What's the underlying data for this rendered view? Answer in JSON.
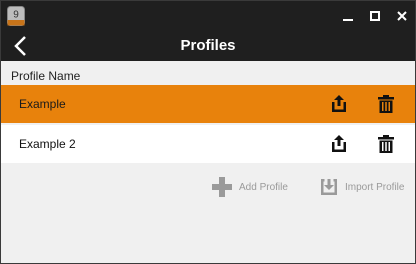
{
  "titlebar": {
    "app_badge": "9",
    "minimize_glyph": "_",
    "maximize_glyph": "□",
    "close_glyph": "✕"
  },
  "navbar": {
    "title": "Profiles",
    "back_icon": "chevron-left-icon"
  },
  "profiles": {
    "column_header": "Profile Name",
    "rows": [
      {
        "name": "Example",
        "selected": true
      },
      {
        "name": "Example 2",
        "selected": false
      }
    ],
    "row_icons": [
      "export-icon",
      "trash-icon"
    ]
  },
  "actions": {
    "add_label": "Add Profile",
    "import_label": "Import Profile"
  },
  "colors": {
    "accent": "#e8820c",
    "titlebar": "#1f1f1f",
    "background": "#f0f0f0",
    "muted": "#9a9a9a"
  }
}
